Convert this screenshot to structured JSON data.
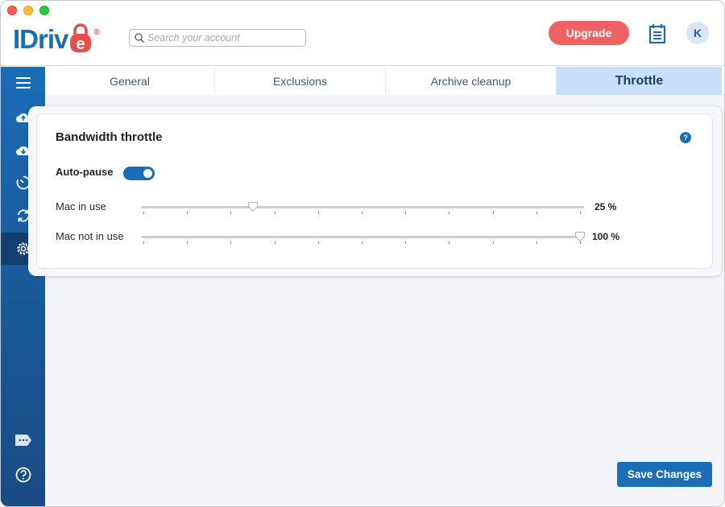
{
  "window": {
    "controls": [
      "close",
      "minimize",
      "maximize"
    ]
  },
  "header": {
    "logo_text": "IDriv",
    "logo_e": "e",
    "logo_reg": "®",
    "search": {
      "placeholder": "Search your account",
      "value": ""
    },
    "upgrade_label": "Upgrade",
    "calendar_icon": "calendar-icon",
    "avatar_initial": "K"
  },
  "sidebar": {
    "items": [
      {
        "name": "menu",
        "icon": "hamburger-menu-icon",
        "active": false
      },
      {
        "name": "backup",
        "icon": "cloud-upload-icon",
        "active": false
      },
      {
        "name": "restore",
        "icon": "cloud-download-icon",
        "active": false
      },
      {
        "name": "scheduler",
        "icon": "clock-icon",
        "active": false
      },
      {
        "name": "sync",
        "icon": "sync-icon",
        "active": false
      },
      {
        "name": "settings",
        "icon": "gear-icon",
        "active": true
      },
      {
        "name": "feedback",
        "icon": "chat-tag-icon",
        "active": false
      },
      {
        "name": "help",
        "icon": "help-circle-icon",
        "active": false
      }
    ]
  },
  "tabs": [
    {
      "label": "General",
      "active": false
    },
    {
      "label": "Exclusions",
      "active": false
    },
    {
      "label": "Archive cleanup",
      "active": false
    },
    {
      "label": "Throttle",
      "active": true
    }
  ],
  "panel": {
    "title": "Bandwidth throttle",
    "help_icon": "?",
    "autopause": {
      "label": "Auto-pause",
      "enabled": true
    },
    "sliders": [
      {
        "label": "Mac in use",
        "value": 25,
        "value_text": "25 %",
        "min": 0,
        "max": 100,
        "ticks": 11
      },
      {
        "label": "Mac not in use",
        "value": 100,
        "value_text": "100 %",
        "min": 0,
        "max": 100,
        "ticks": 11
      }
    ]
  },
  "footer": {
    "save_label": "Save Changes"
  },
  "colors": {
    "brand_blue": "#1a6db7",
    "upgrade_red": "#ef6262",
    "active_tab_bg": "#c9dffb"
  }
}
